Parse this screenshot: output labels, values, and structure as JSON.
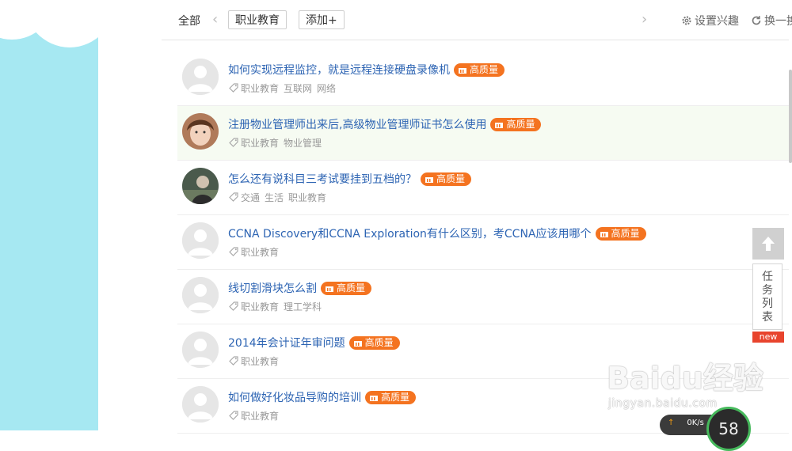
{
  "topbar": {
    "tab_all": "全部",
    "prev_arrow": "‹",
    "next_arrow": "›",
    "chip_label": "职业教育",
    "add_label": "添加+",
    "settings_label": "设置兴趣",
    "refresh_label": "换一换"
  },
  "questions": [
    {
      "title": "如何实现远程监控，就是远程连接硬盘录像机",
      "badge": "高质量",
      "tags": [
        "职业教育",
        "互联网",
        "网络"
      ],
      "avatar": "default"
    },
    {
      "title": "注册物业管理师出来后,高级物业管理师证书怎么使用",
      "badge": "高质量",
      "tags": [
        "职业教育",
        "物业管理"
      ],
      "avatar": "photo-girl"
    },
    {
      "title": "怎么还有说科目三考试要挂到五档的？",
      "badge": "高质量",
      "tags": [
        "交通",
        "生活",
        "职业教育"
      ],
      "avatar": "photo-dark"
    },
    {
      "title": "CCNA Discovery和CCNA Exploration有什么区别，考CCNA应该用哪个",
      "badge": "高质量",
      "tags": [
        "职业教育"
      ],
      "avatar": "default"
    },
    {
      "title": "线切割滑块怎么割",
      "badge": "高质量",
      "tags": [
        "职业教育",
        "理工学科"
      ],
      "avatar": "default"
    },
    {
      "title": "2014年会计证年审问题",
      "badge": "高质量",
      "tags": [
        "职业教育"
      ],
      "avatar": "default"
    },
    {
      "title": "如何做好化妆品导购的培训",
      "badge": "高质量",
      "tags": [
        "职业教育"
      ],
      "avatar": "default"
    }
  ],
  "sidebar": {
    "task_list_label": "任务列表",
    "new_badge": "new"
  },
  "overlay": {
    "speed_text": "0K/s",
    "gauge_value": "58"
  },
  "watermark": {
    "brand": "Baidu经验",
    "url": "jingyan.baidu.com"
  },
  "colors": {
    "left_background": "#a6e8f2",
    "link": "#2d64b3",
    "badge": "#f47320",
    "highlight_row": "#f6fbf2"
  }
}
